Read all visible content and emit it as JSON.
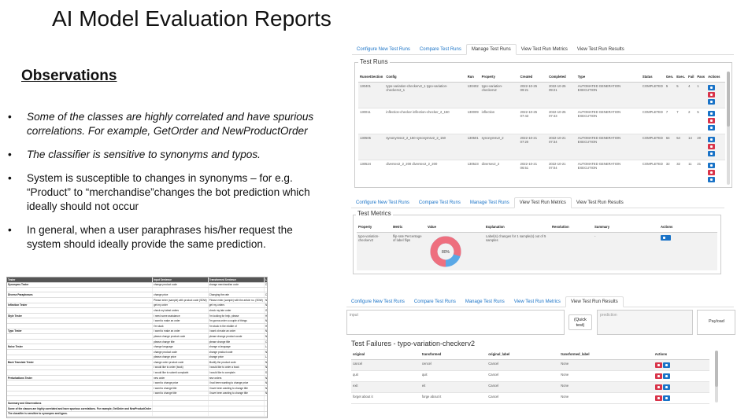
{
  "title": "AI Model Evaluation Reports",
  "observations": {
    "heading": "Observations",
    "bullets": [
      {
        "text": "Some of the classes are highly correlated and have spurious correlations. For example, GetOrder and NewProductOrder",
        "italic": true
      },
      {
        "text": "The classifier is sensitive to synonyms and typos.",
        "italic": true
      },
      {
        "text": "System is susceptible to changes in synonyms – for e.g. “Product” to “merchandise”changes the bot prediction which ideally should not occur",
        "italic": false
      },
      {
        "text": "In general, when a user paraphrases his/her request the system should ideally provide the same prediction.",
        "italic": false
      }
    ],
    "bullet_char": "•"
  },
  "mini_table": {
    "headers": [
      "Tester",
      "Input Sentence",
      "Transformed Sentence",
      "Label_before",
      "Label_after"
    ],
    "rows": [
      [
        "Synonyms Tester",
        "change product code",
        "change merchandise code",
        "Cancel",
        "Nlines"
      ],
      [
        "",
        "",
        "",
        "",
        ""
      ],
      [
        "Diverse Paraphrases",
        "change price",
        "Changing the rate",
        "Cancel",
        "Nlines"
      ],
      [
        "",
        "Please enter (sample) with product code (SDW)",
        "Please enter (sample) with the article no. (SDW)",
        "NewProductOrder",
        "CreateClient"
      ],
      [
        "Inflection Tester",
        "get my order",
        "get my orders",
        "NewProductOrder",
        "GetOrders"
      ],
      [
        "",
        "check my latest orders",
        "check my late order",
        "GetOrder",
        "NewProductOrder"
      ],
      [
        "Style Tester",
        "I need some assistance",
        "I'm looking for help, please",
        "Help",
        "CreateClient"
      ],
      [
        "",
        "I want to make an order",
        "I'm gonna order a couple of things",
        "NewProductOrder",
        "CreateClient"
      ],
      [
        "",
        "I'm stuck",
        "I'm stuck in the middle of",
        "Help",
        "CreateClient"
      ],
      [
        "Typo Tester",
        "I want to make an order",
        "I want ot make an order",
        "NewProductOrder",
        "Nlines"
      ],
      [
        "",
        "please change product code",
        "please change product coode",
        "NewProductOrder",
        "Nlines"
      ],
      [
        "",
        "please change title",
        "please change tilte",
        "Cancel",
        "Nlines"
      ],
      [
        "Noise Tester",
        "change language",
        "change a language",
        "Language",
        "Nlines"
      ],
      [
        "",
        "change product code",
        "change product code",
        "NewProductOrder",
        "Nlines"
      ],
      [
        "",
        "please change price",
        "change price",
        "Language",
        "Nlines"
      ],
      [
        "Back Translate Tester",
        "change order product code",
        "Modify the product code",
        "NewProductOrder",
        "Nlines"
      ],
      [
        "",
        "I would like to order (book)",
        "I would like to order a book",
        "NewProductOrder",
        "Nlines"
      ],
      [
        "",
        "I would like to submit complaint",
        "I would like to complain",
        "SubmitComplaint",
        "Nlines"
      ],
      [
        "Perturbations Tester",
        "new order",
        "new orders",
        "NewProductOrder",
        "GetOrders"
      ],
      [
        "",
        "I want to change price",
        "I had been wanting to change price",
        "None",
        "CreateClient"
      ],
      [
        "",
        "I want to change title",
        "I have been wanting to change title",
        "None",
        "CreateClient"
      ],
      [
        "",
        "I want to change title",
        "I have been wanting to change title",
        "None",
        "CreateClient"
      ],
      [
        "",
        "",
        "",
        "",
        ""
      ],
      [
        "Summary and Observations",
        "",
        "",
        "",
        ""
      ],
      [
        "Some of the classes are highly correlated and have spurious correlations. For example, GetOrder and NewProductOrder",
        "",
        "",
        "",
        ""
      ],
      [
        "The classifier is sensitive to synonyms and typos.",
        "",
        "",
        "",
        ""
      ]
    ]
  },
  "panel1": {
    "tabs": [
      "Configure New Test Runs",
      "Compare Test Runs",
      "Manage Test Runs",
      "View Test Run Metrics",
      "View Test Run Results"
    ],
    "active_tab": 2,
    "legend": "Test Runs",
    "headers": [
      "RunsetSection",
      "Config",
      "Run",
      "Property",
      "Created",
      "Completed",
      "Type",
      "Status",
      "Gen.",
      "Exec.",
      "Fail",
      "Pass",
      "Actions"
    ],
    "rows": [
      [
        "130401",
        "typo-variation-checkerv2_1 typo-variation-checkerv2_1",
        "130402",
        "typo-variation-checkerv2",
        "2022-10-25 09:21",
        "2022-10-25 09:21",
        "AUTOMATED GENERATION EXECUTION",
        "COMPLETED",
        "5",
        "5",
        "4",
        "1"
      ],
      [
        "130011",
        "inflection-checker inflection-checker_2_150",
        "130009",
        "inflection",
        "2022-10-25 07:43",
        "2022-10-25 07:43",
        "AUTOMATED GENERATION EXECUTION",
        "COMPLETED",
        "7",
        "7",
        "2",
        "5"
      ],
      [
        "130505",
        "synonymsv2_2_150 synonymsv2_2_150",
        "130501",
        "synonymsv2_2",
        "2022-10-21 07:20",
        "2022-10-21 07:34",
        "AUTOMATED GENERATION EXECUTION",
        "COMPLETED",
        "64",
        "54",
        "14",
        "20"
      ],
      [
        "130524",
        "diversev2_2_200 diversev2_2_200",
        "130523",
        "diversev2_2",
        "2022-10-21 06:51",
        "2022-10-21 07:04",
        "AUTOMATED GENERATION EXECUTION",
        "COMPLETED",
        "32",
        "32",
        "11",
        "21"
      ]
    ]
  },
  "panel2": {
    "tabs": [
      "Configure New Test Runs",
      "Compare Test Runs",
      "Manage Test Runs",
      "View Test Run Metrics",
      "View Test Run Results"
    ],
    "active_tab": 3,
    "legend": "Test Metrics",
    "headers": [
      "Property",
      "Metric",
      "Value",
      "Explanation",
      "Resolution",
      "Summary",
      "Actions"
    ],
    "row": {
      "property": "typo-variation-checkerv2",
      "metric": "flip-rate Percentage of label flips",
      "explanation": "Label(s) changes for 1 sample(s) out of 5 samples",
      "resolution": "",
      "summary": "-"
    },
    "donut": {
      "value_label": "80%",
      "fraction": 0.8,
      "color_main": "#ee6f7e",
      "color_rest": "#5aa8e6"
    }
  },
  "panel3": {
    "tabs": [
      "Configure New Test Runs",
      "Compare Test Runs",
      "Manage Test Runs",
      "View Test Run Metrics",
      "View Test Run Results"
    ],
    "active_tab": 4,
    "input_label": "input",
    "quick_test": "(Quick test)",
    "prediction_label": "prediction",
    "payload_label": "Payload",
    "legend": "Test Failures - typo-variation-checkerv2",
    "headers": [
      "original",
      "transformed",
      "original_label",
      "transformed_label",
      "Actions"
    ],
    "rows": [
      [
        "cancel",
        "cencel",
        "Cancel",
        "None"
      ],
      [
        "quit",
        "quit",
        "Cancel",
        "None"
      ],
      [
        "exit",
        "eit",
        "Cancel",
        "None"
      ],
      [
        "forget about it",
        "forge about it",
        "Cancel",
        "None"
      ]
    ]
  }
}
